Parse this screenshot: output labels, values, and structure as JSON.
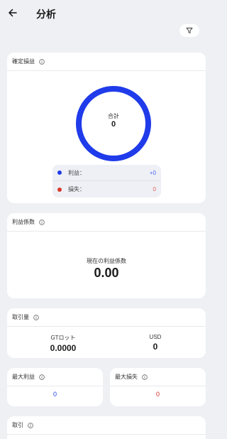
{
  "header": {
    "title": "分析"
  },
  "pnl": {
    "title": "確定損益",
    "total_label": "合計",
    "total_value": "0",
    "donut_color": "#1f3bea",
    "legend": [
      {
        "label": "利益：",
        "value": "+0",
        "color": "#1f3bea",
        "value_color": "#4a66f0"
      },
      {
        "label": "損失：",
        "value": "0",
        "color": "#d93a2b",
        "value_color": "#e0675d"
      }
    ]
  },
  "profit_factor": {
    "title": "利益係数",
    "label": "現在の利益係数",
    "value": "0.00"
  },
  "volume": {
    "title": "取引量",
    "items": [
      {
        "label": "GTロット",
        "value": "0.0000"
      },
      {
        "label": "USD",
        "value": "0"
      }
    ]
  },
  "max_profit": {
    "title": "最大利益",
    "value": "0",
    "color": "#1f3bea"
  },
  "max_loss": {
    "title": "最大損失",
    "value": "0",
    "color": "#d12a1f"
  },
  "trades": {
    "title": "取引"
  },
  "icons": {
    "back": "arrow-left-icon",
    "filter": "filter-icon",
    "info": "info-icon"
  }
}
